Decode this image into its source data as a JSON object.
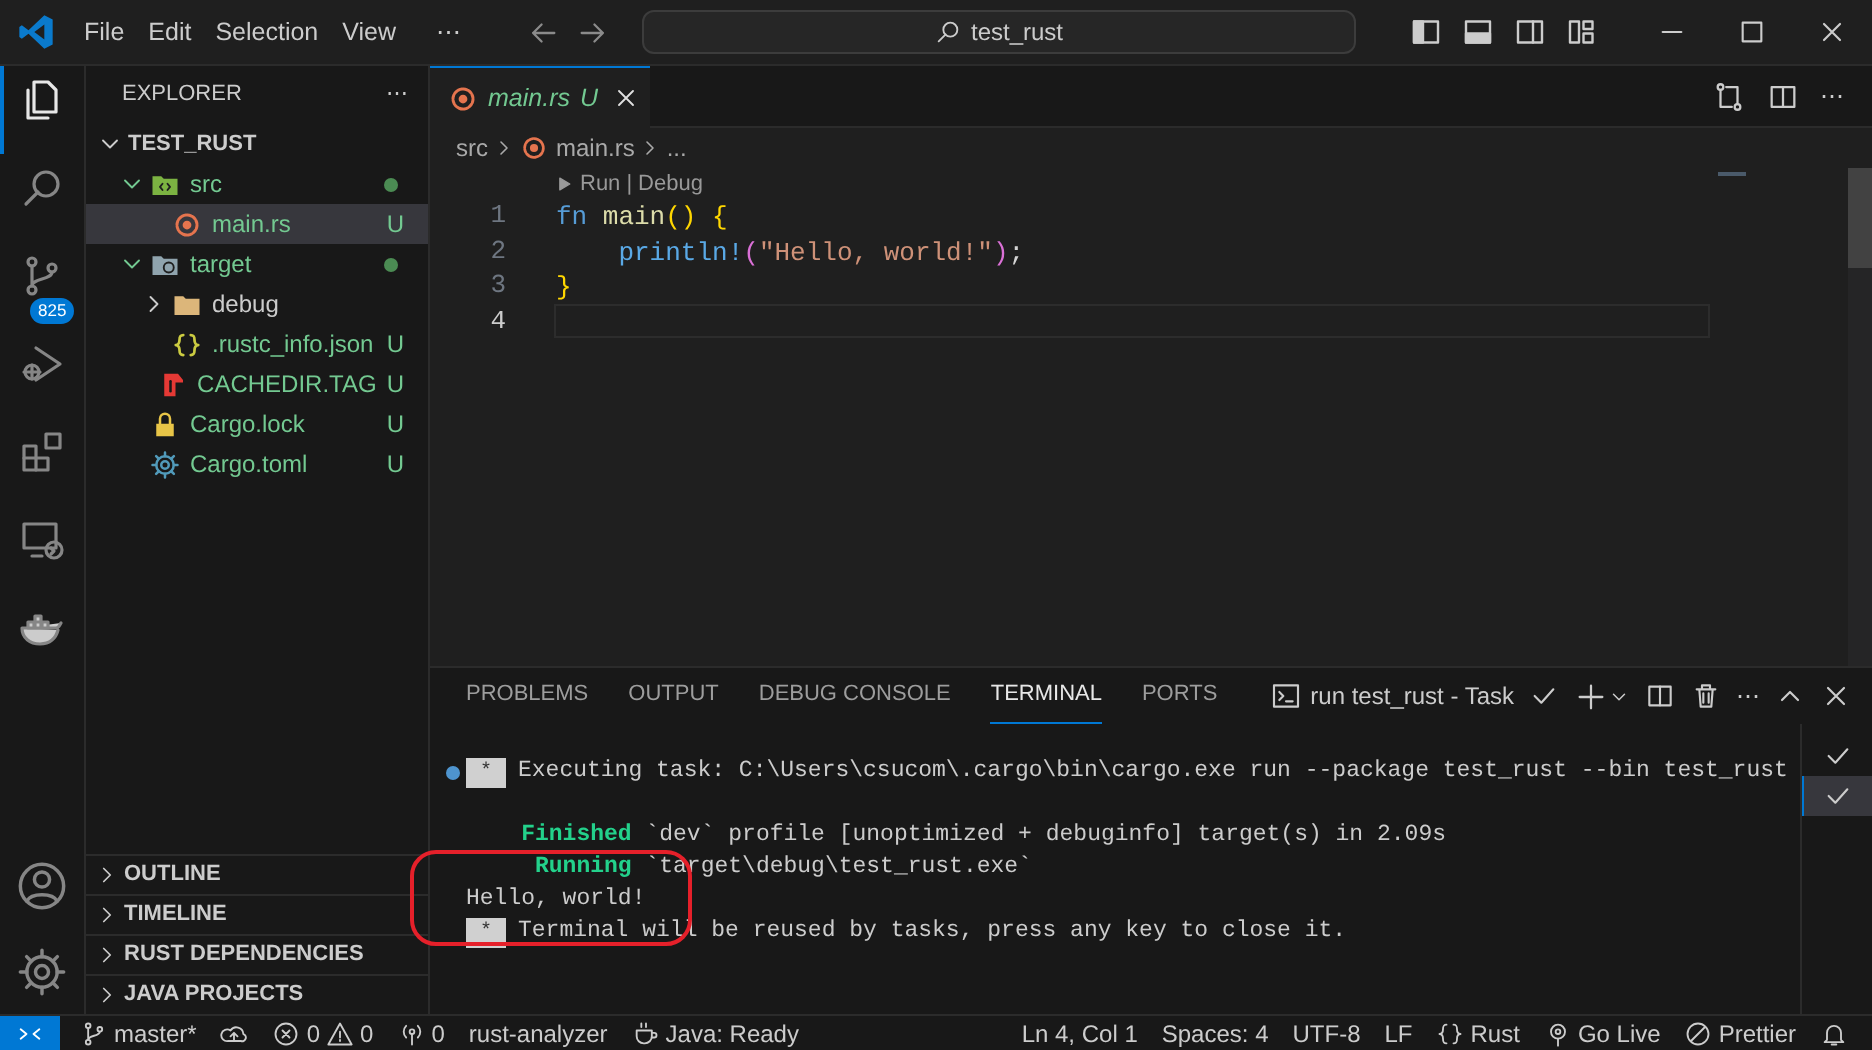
{
  "title_bar": {
    "menus": [
      "File",
      "Edit",
      "Selection",
      "View"
    ],
    "more": "⋯",
    "search": "test_rust",
    "layout_toggles": [
      {
        "kind": "sidebar",
        "on": true
      },
      {
        "kind": "panel",
        "on": true
      },
      {
        "kind": "secondary",
        "on": false
      },
      {
        "kind": "customize"
      }
    ]
  },
  "activity_bar": [
    {
      "kind": "explorer",
      "selected": true
    },
    {
      "kind": "search",
      "selected": false
    },
    {
      "kind": "scm",
      "selected": false,
      "badge": "825"
    },
    {
      "kind": "debug",
      "selected": false
    },
    {
      "kind": "extensions",
      "selected": false
    },
    {
      "kind": "remote",
      "selected": false
    },
    {
      "kind": "docker",
      "selected": false
    }
  ],
  "activity_bottom": [
    {
      "kind": "account"
    },
    {
      "kind": "settings"
    }
  ],
  "explorer": {
    "title": "EXPLORER",
    "more": "⋯",
    "root": {
      "label": "TEST_RUST",
      "expanded": true,
      "children": [
        {
          "label": "src",
          "kind": "source",
          "expanded": true,
          "dot": true,
          "selected": false,
          "children": [
            {
              "label": "main.rs",
              "kind": "rust",
              "git": "U",
              "selected": true
            }
          ]
        },
        {
          "label": "target",
          "kind": "target",
          "expanded": true,
          "dot": true,
          "selected": false,
          "children": [
            {
              "label": "debug",
              "kind": "folder",
              "expanded": false,
              "selected": false
            },
            {
              "label": ".rustc_info.json",
              "kind": "json",
              "git": "U",
              "selected": false
            },
            {
              "label": "CACHEDIR.TAG",
              "kind": "tag",
              "git": "U",
              "selected": false
            }
          ]
        },
        {
          "label": "Cargo.lock",
          "kind": "lock",
          "git": "U",
          "selected": false
        },
        {
          "label": "Cargo.toml",
          "kind": "config",
          "git": "U",
          "selected": false
        }
      ]
    }
  },
  "sections": [
    {
      "label": "OUTLINE",
      "expanded": false
    },
    {
      "label": "TIMELINE",
      "expanded": false
    },
    {
      "label": "RUST DEPENDENCIES",
      "expanded": false
    },
    {
      "label": "JAVA PROJECTS",
      "expanded": false
    }
  ],
  "editor": {
    "tabs": [
      {
        "label": "main.rs",
        "kind": "rust",
        "git": "U",
        "preview": true,
        "selected": true
      }
    ],
    "more": "⋯",
    "breadcrumbs": [
      {
        "label": "src"
      },
      {
        "label": "main.rs",
        "kind": "rust"
      },
      {
        "label": "..."
      }
    ],
    "codelens": {
      "items": [
        "Run",
        "Debug"
      ],
      "separator": "|"
    },
    "lines": [
      {
        "number": "1",
        "current": false,
        "tokens": [
          {
            "text": "fn ",
            "kind": "keyword"
          },
          {
            "text": "main",
            "kind": "function"
          },
          {
            "text": "() {",
            "kind": "bracket1"
          }
        ]
      },
      {
        "number": "2",
        "current": false,
        "tokens": [
          {
            "text": "    println!",
            "kind": "macro"
          },
          {
            "text": "(",
            "kind": "bracket2"
          },
          {
            "text": "\"Hello, world!\"",
            "kind": "string"
          },
          {
            "text": ")",
            "kind": "bracket2"
          },
          {
            "text": ";"
          }
        ]
      },
      {
        "number": "3",
        "current": false,
        "tokens": [
          {
            "text": "}",
            "kind": "bracket1"
          }
        ]
      },
      {
        "number": "4",
        "current": true
      }
    ]
  },
  "panel": {
    "tabs": [
      {
        "label": "PROBLEMS",
        "selected": false
      },
      {
        "label": "OUTPUT",
        "selected": false
      },
      {
        "label": "DEBUG CONSOLE",
        "selected": false
      },
      {
        "label": "TERMINAL",
        "selected": true
      },
      {
        "label": "PORTS",
        "selected": false
      }
    ],
    "terminal_title": "run test_rust - Task",
    "more": "⋯",
    "lines": [
      {
        "kind": "task",
        "badge": "*",
        "text": "Executing task: C:\\Users\\csucom\\.cargo\\bin\\cargo.exe run --package test_rust --bin test_rust"
      },
      {
        "kind": "blank"
      },
      {
        "kind": "status",
        "label": "    Finished",
        "text": " `dev` profile [unoptimized + debuginfo] target(s) in 2.09s"
      },
      {
        "kind": "status",
        "label": "     Running",
        "text": " `target\\debug\\test_rust.exe`"
      },
      {
        "kind": "output",
        "text": "Hello, world!"
      },
      {
        "kind": "notice",
        "badge": "*",
        "text": "Terminal will be reused by tasks, press any key to close it."
      }
    ],
    "terminals": [
      {
        "selected": false
      },
      {
        "selected": true
      }
    ]
  },
  "status_bar": {
    "left": [
      {
        "kind": "remote"
      },
      {
        "kind": "branch",
        "text": "master*"
      },
      {
        "kind": "sync"
      },
      {
        "kind": "problems",
        "errors": "0",
        "warnings": "0"
      },
      {
        "kind": "ports",
        "text": "0"
      },
      {
        "kind": "plain",
        "text": "rust-analyzer"
      },
      {
        "kind": "java",
        "text": "Java: Ready"
      }
    ],
    "right": [
      {
        "kind": "plain",
        "text": "Ln 4, Col 1"
      },
      {
        "kind": "plain",
        "text": "Spaces: 4"
      },
      {
        "kind": "plain",
        "text": "UTF-8"
      },
      {
        "kind": "plain",
        "text": "LF"
      },
      {
        "kind": "language",
        "text": "Rust"
      },
      {
        "kind": "live",
        "text": "Go Live"
      },
      {
        "kind": "prettier",
        "text": "Prettier"
      },
      {
        "kind": "bell"
      }
    ]
  }
}
